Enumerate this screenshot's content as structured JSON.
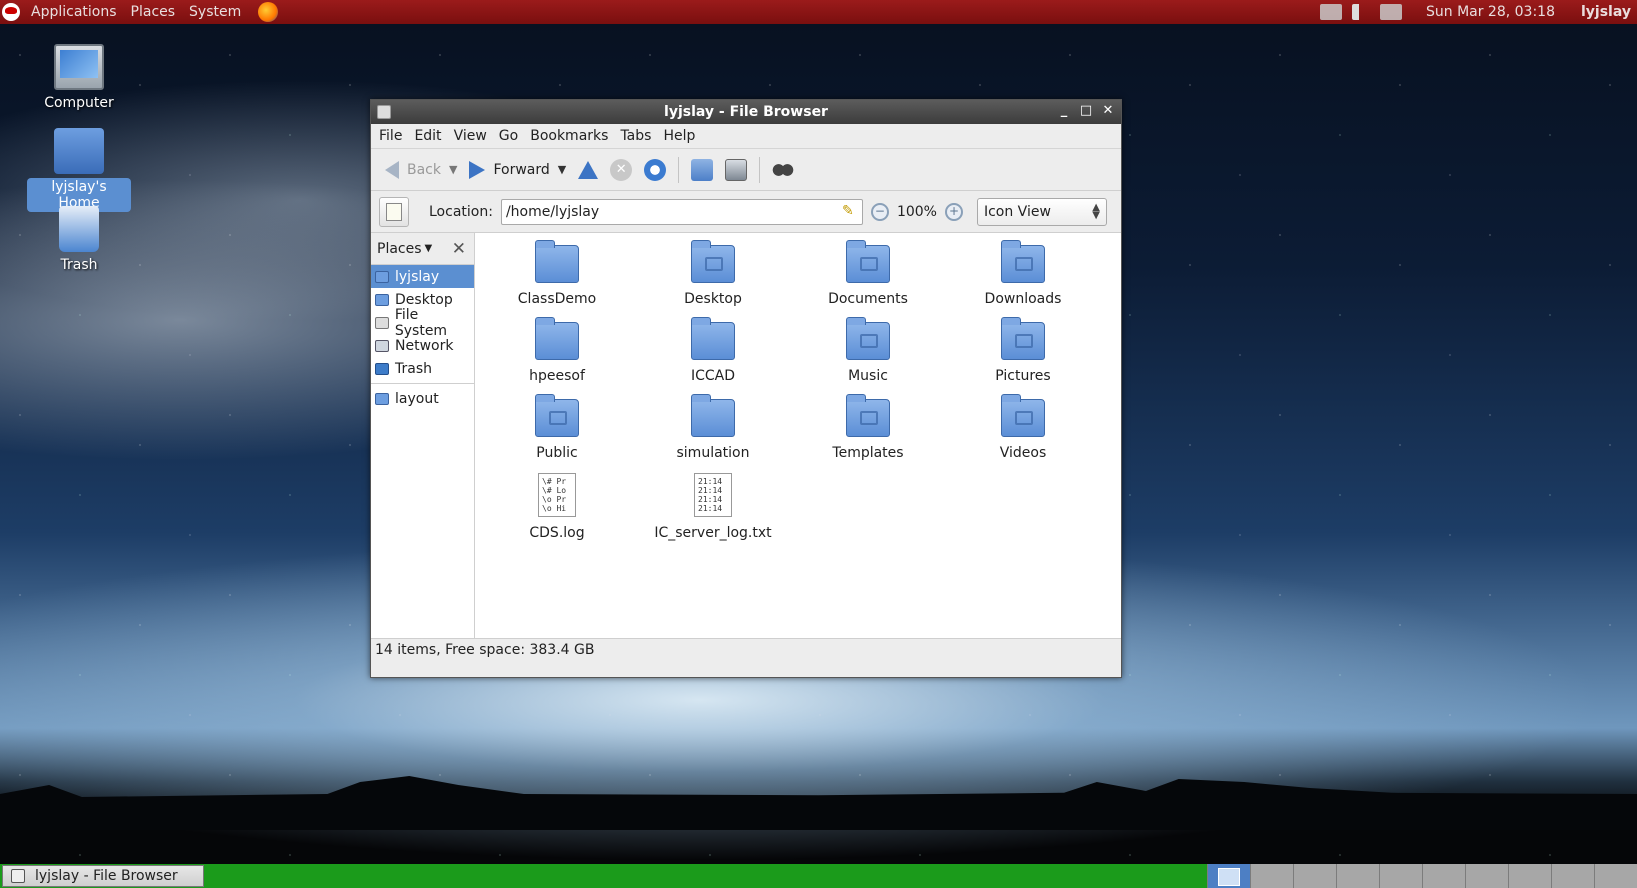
{
  "top_panel": {
    "menus": [
      "Applications",
      "Places",
      "System"
    ],
    "clock": "Sun Mar 28, 03:18",
    "user": "lyjslay"
  },
  "desktop": {
    "icons": [
      {
        "label": "Computer"
      },
      {
        "label": "lyjslay's Home"
      },
      {
        "label": "Trash"
      }
    ]
  },
  "window": {
    "title": "lyjslay - File Browser",
    "menubar": [
      "File",
      "Edit",
      "View",
      "Go",
      "Bookmarks",
      "Tabs",
      "Help"
    ],
    "toolbar": {
      "back": "Back",
      "forward": "Forward"
    },
    "location": {
      "label": "Location:",
      "value": "/home/lyjslay"
    },
    "zoom": "100%",
    "view_mode": "Icon View",
    "sidebar": {
      "header": "Places",
      "items": [
        {
          "label": "lyjslay"
        },
        {
          "label": "Desktop"
        },
        {
          "label": "File System"
        },
        {
          "label": "Network"
        },
        {
          "label": "Trash"
        }
      ],
      "bookmarks": [
        {
          "label": "layout"
        }
      ]
    },
    "files": [
      {
        "name": "ClassDemo"
      },
      {
        "name": "Desktop"
      },
      {
        "name": "Documents"
      },
      {
        "name": "Downloads"
      },
      {
        "name": "hpeesof"
      },
      {
        "name": "ICCAD"
      },
      {
        "name": "Music"
      },
      {
        "name": "Pictures"
      },
      {
        "name": "Public"
      },
      {
        "name": "simulation"
      },
      {
        "name": "Templates"
      },
      {
        "name": "Videos"
      },
      {
        "name": "CDS.log",
        "preview": "\\# Pr\n\\# Lo\n\\o Pr\n\\o Hi"
      },
      {
        "name": "IC_server_log.txt",
        "preview": "21:14\n21:14\n21:14\n21:14"
      }
    ],
    "status": "14 items, Free space: 383.4 GB"
  },
  "taskbar": {
    "task_label": "lyjslay - File Browser"
  }
}
